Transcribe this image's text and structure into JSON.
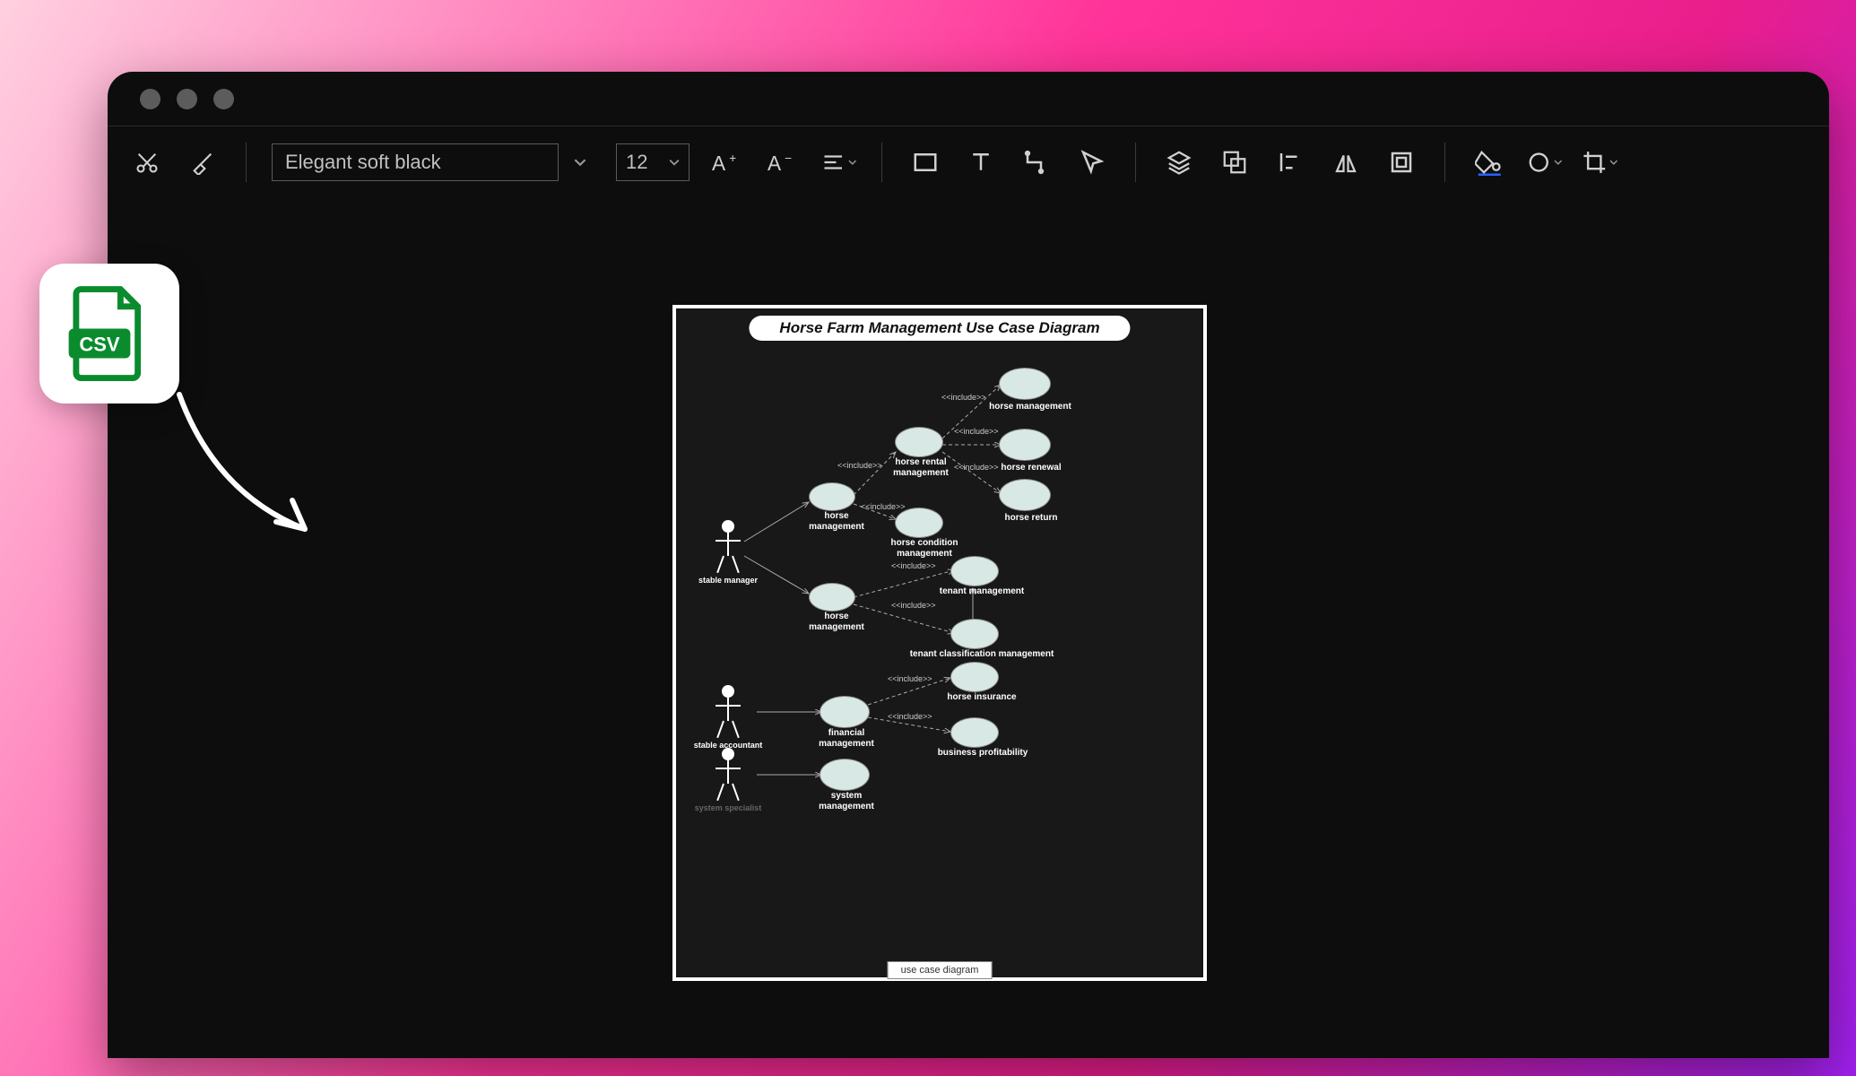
{
  "toolbar": {
    "font_name": "Elegant soft black",
    "font_size": "12"
  },
  "diagram": {
    "title": "Horse Farm Management Use Case Diagram",
    "footer": "use case diagram",
    "actors": {
      "stable_manager": "stable manager",
      "stable_accountant": "stable accountant",
      "system_specialist": "system specialist"
    },
    "use_cases": {
      "horse_management_top": "horse management",
      "horse_renewal": "horse renewal",
      "horse_return": "horse return",
      "horse_rental_management": "horse rental\nmanagement",
      "horse_management_1": "horse\nmanagement",
      "horse_management_2": "horse\nmanagement",
      "horse_condition_management": "horse condition\nmanagement",
      "tenant_management": "tenant management",
      "tenant_classification_management": "tenant classification management",
      "financial_management": "financial\nmanagement",
      "horse_insurance": "horse insurance",
      "business_profitability": "business profitability",
      "system_management": "system\nmanagement"
    },
    "include_label": "<<include>>"
  },
  "csv_badge": "CSV"
}
